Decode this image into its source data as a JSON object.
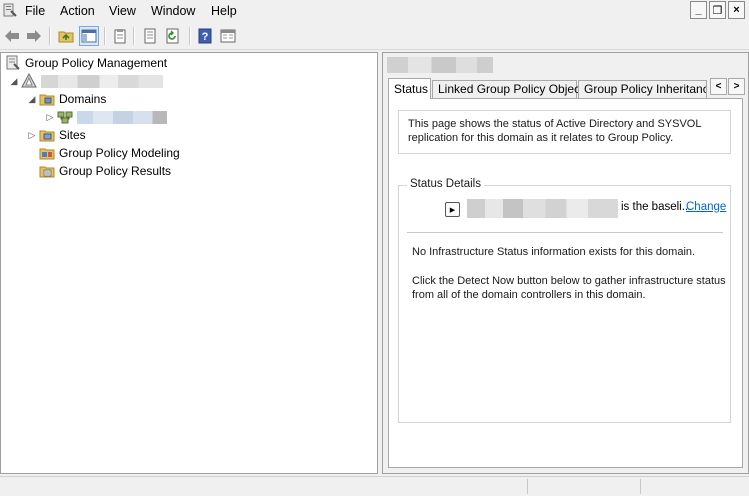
{
  "menu": {
    "items": [
      "File",
      "Action",
      "View",
      "Window",
      "Help"
    ]
  },
  "window_controls": {
    "minimize": "_",
    "restore": "❐",
    "close": "×"
  },
  "toolbar": {
    "icons": [
      "back-icon",
      "forward-icon",
      "up-folder-icon",
      "show-hide-console-tree-icon",
      "properties-icon",
      "export-list-icon",
      "refresh-icon",
      "help-icon",
      "new-window-icon"
    ]
  },
  "tree": {
    "root": "Group Policy Management",
    "domains": "Domains",
    "sites": "Sites",
    "modeling": "Group Policy Modeling",
    "results": "Group Policy Results"
  },
  "tabs": [
    "Status",
    "Linked Group Policy Objects",
    "Group Policy Inheritance"
  ],
  "tab_scroll": {
    "left": "<",
    "right": ">"
  },
  "status_page": {
    "description": "This page shows the status of Active Directory and SYSVOL replication for this domain as it relates to Group Policy.",
    "details_title": "Status Details",
    "baseline_text": "is the baseli...",
    "change_link": "Change",
    "no_info": "No Infrastructure Status information exists for this domain.",
    "detect_info": "Click the Detect Now button below to gather infrastructure status from all of the domain controllers in this domain."
  },
  "colors": {
    "link": "#0066cc",
    "selection": "#cce0f5",
    "pane_border": "#a0a0a0"
  }
}
